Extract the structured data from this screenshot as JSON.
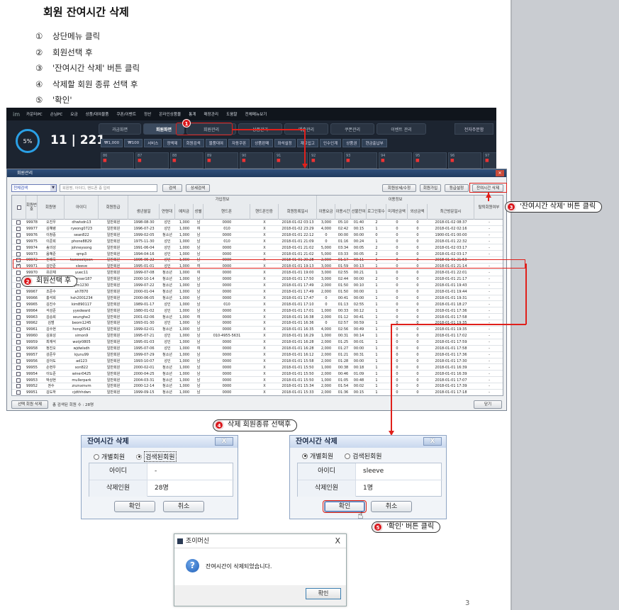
{
  "doc": {
    "title": "회원 잔여시간 삭제",
    "steps": [
      {
        "num": "①",
        "text": "상단메뉴 클릭"
      },
      {
        "num": "②",
        "text": "회원선택 후"
      },
      {
        "num": "③",
        "text": "'잔여시간 삭제' 버튼 클릭"
      },
      {
        "num": "④",
        "text": "삭제할 회원 종류 선택 후"
      },
      {
        "num": "⑤",
        "text": "'확인'"
      }
    ],
    "page_number": "3"
  },
  "app": {
    "logo": "im",
    "menu": [
      "카운터PC",
      "손님PC",
      "요금",
      "상품/대여물품",
      "쿠폰/이벤트",
      "정산",
      "온라인상품몰",
      "통계",
      "매장관리",
      "도움말",
      "전체메뉴보기"
    ],
    "gauge": "5%",
    "count": "11 | 221",
    "tabs": [
      {
        "label": "과금화면",
        "active": false
      },
      {
        "label": "회원화면",
        "active": true
      },
      {
        "label": "회원관리",
        "active": false
      },
      {
        "label": "상품관리",
        "active": false
      },
      {
        "label": "매출관리",
        "active": false
      },
      {
        "label": "쿠폰관리",
        "active": false
      },
      {
        "label": "이벤트 관리",
        "active": false
      }
    ],
    "right_tab": "전자주문함",
    "toolbar": [
      "₩1,000",
      "₩100",
      "서비스",
      "정액제",
      "회원검색",
      "물품대여",
      "자동쿠폰",
      "상품판매",
      "좌석설정",
      "재고입고",
      "인수인계",
      "상품권",
      "현금출납부"
    ],
    "seats": [
      "86",
      "87",
      "88",
      "89",
      "90",
      "91",
      "92",
      "93",
      "94",
      "95",
      "96",
      "97"
    ]
  },
  "window": {
    "title": "회원관리",
    "search_select": "전체검색",
    "search_placeholder": "회원명, 아이디, 핸드폰 중 입력",
    "search_btn": "검색",
    "detail_search_btn": "상세검색",
    "btn_detail_edit": "회원상세/수정",
    "btn_join": "회원가입",
    "btn_grade": "등급설정",
    "btn_delete_time": "잔여시간 삭제",
    "group_join": "가입정보",
    "group_use": "이용정보",
    "headers": [
      "회원번호",
      "회원명",
      "아이디",
      "회원등급",
      "생년월일",
      "연령대",
      "예치금",
      "성별",
      "핸드폰",
      "핸드폰인증",
      "회원등록일시",
      "이용요금",
      "이용시간",
      "선불잔여",
      "로그인횟수",
      "미계산금액",
      "외상금액",
      "최근방문일시",
      "탈퇴회원여부"
    ],
    "rows": [
      [
        "99978",
        "오진우",
        "dhwlsdn13",
        "일반회원",
        "1998-08-30",
        "성인",
        "1,000",
        "남",
        "0000",
        "X",
        "2018-01-02 03:13",
        "3,000",
        "05:10",
        "01:40",
        "2",
        "0",
        "0",
        "2018-01-02 08:37",
        "-"
      ],
      [
        "99977",
        "김혜령",
        "ryeong0723",
        "일반회원",
        "1996-07-23",
        "성인",
        "1,000",
        "여",
        "010",
        "X",
        "2018-01-02 23:29",
        "4,000",
        "02:42",
        "00:15",
        "1",
        "0",
        "0",
        "2018-01-02 02:16",
        "-"
      ],
      [
        "99976",
        "이창중",
        "sean822",
        "일반회원",
        "1999-02-05",
        "청소년",
        "1,000",
        "남",
        "0000",
        "X",
        "2018-01-01 22:12",
        "0",
        "00:00",
        "00:00",
        "0",
        "0",
        "0",
        "1900-01-01 00:00",
        "-"
      ],
      [
        "99975",
        "이준희",
        "phone8829",
        "일반회원",
        "1975-11-30",
        "성인",
        "1,000",
        "남",
        "010",
        "X",
        "2018-01-01 21:09",
        "0",
        "01:16",
        "00:24",
        "1",
        "0",
        "0",
        "2018-01-01 22:32",
        "-"
      ],
      [
        "99974",
        "송의성",
        "johneysong",
        "일반회원",
        "1991-06-04",
        "성인",
        "1,000",
        "남",
        "0000",
        "X",
        "2018-01-01 21:02",
        "5,000",
        "03:34",
        "00:05",
        "2",
        "0",
        "0",
        "2018-01-02 03:17",
        "-"
      ],
      [
        "99973",
        "음혜준",
        "qmp3",
        "일반회원",
        "1994-04-16",
        "성인",
        "1,000",
        "남",
        "0000",
        "X",
        "2018-01-01 21:02",
        "5,000",
        "03:33",
        "00:05",
        "2",
        "0",
        "0",
        "2018-01-02 03:17",
        "-"
      ],
      [
        "99972",
        "전태육",
        "taewookjeon",
        "일반회원",
        "1996-06-22",
        "성인",
        "1,000",
        "남",
        "0000",
        "X",
        "2018-01-01 20:28",
        "2,000",
        "01:17",
        "00:11",
        "1",
        "0",
        "0",
        "2018-01-01 21:53",
        "-"
      ],
      [
        "99971",
        "김민준",
        "sleeve",
        "일반회원",
        "1995-01-01",
        "성인",
        "1,000",
        "여",
        "0000",
        "X",
        "2018-01-01 19:13",
        "3,000",
        "01:59",
        "00:13",
        "1",
        "0",
        "0",
        "2018-01-01 21:14",
        "-"
      ],
      [
        "99970",
        "유은채",
        "yuec11",
        "일반회원",
        "1999-07-08",
        "청소년",
        "1,000",
        "여",
        "0000",
        "X",
        "2018-01-01 19:00",
        "3,000",
        "02:55",
        "00:21",
        "1",
        "0",
        "0",
        "2018-01-01 22:01",
        "-"
      ],
      [
        "99969",
        "박지훈",
        "wlgnser187",
        "일반회원",
        "2000-10-14",
        "청소년",
        "1,000",
        "남",
        "0000",
        "X",
        "2018-01-01 17:50",
        "3,000",
        "02:44",
        "00:00",
        "2",
        "0",
        "0",
        "2018-01-01 21:17",
        "-"
      ],
      [
        "99968",
        "이서준",
        "jim1230",
        "일반회원",
        "1999-07-22",
        "청소년",
        "1,000",
        "남",
        "0000",
        "X",
        "2018-01-01 17:49",
        "2,000",
        "01:50",
        "00:10",
        "1",
        "0",
        "0",
        "2018-01-01 19:43",
        "-"
      ],
      [
        "99967",
        "조준수",
        "ah7870",
        "일반회원",
        "2000-01-04",
        "청소년",
        "1,000",
        "남",
        "0000",
        "X",
        "2018-01-01 17:49",
        "2,000",
        "01:50",
        "00:00",
        "1",
        "0",
        "0",
        "2018-01-01 19:44",
        "-"
      ],
      [
        "99966",
        "홍석희",
        "hsh2001234",
        "일반회원",
        "2000-06-05",
        "청소년",
        "1,000",
        "남",
        "0000",
        "X",
        "2018-01-01 17:47",
        "0",
        "00:41",
        "00:00",
        "1",
        "0",
        "0",
        "2018-01-01 19:31",
        "-"
      ],
      [
        "99965",
        "김진수",
        "kim890117",
        "일반회원",
        "1989-01-17",
        "성인",
        "1,000",
        "남",
        "010",
        "X",
        "2018-01-01 17:10",
        "0",
        "01:13",
        "02:55",
        "1",
        "0",
        "0",
        "2018-01-01 18:27",
        "-"
      ],
      [
        "99964",
        "석성준",
        "yyedward",
        "일반회원",
        "1980-01-02",
        "성인",
        "1,000",
        "남",
        "0000",
        "X",
        "2018-01-01 17:01",
        "1,000",
        "00:33",
        "00:12",
        "1",
        "0",
        "0",
        "2018-01-01 17:36",
        "-"
      ],
      [
        "99963",
        "김승희",
        "seunghe2",
        "일반회원",
        "2001-02-06",
        "청소년",
        "1,000",
        "여",
        "0000",
        "X",
        "2018-01-01 16:38",
        "2,000",
        "01:12",
        "00:41",
        "1",
        "0",
        "0",
        "2018-01-01 17:58",
        "-"
      ],
      [
        "99962",
        "김범",
        "beom1245",
        "일반회원",
        "1993-01-30",
        "성인",
        "1,000",
        "남",
        "0000",
        "X",
        "2018-01-01 16:36",
        "0",
        "02:57",
        "00:59",
        "1",
        "0",
        "0",
        "2018-01-01 19:35",
        "-"
      ],
      [
        "99961",
        "김수현",
        "hong0542",
        "일반회원",
        "1999-02-01",
        "청소년",
        "1,000",
        "남",
        "0000",
        "X",
        "2018-01-01 16:35",
        "4,000",
        "02:56",
        "00:49",
        "1",
        "0",
        "0",
        "2018-01-01 19:35",
        "-"
      ],
      [
        "99960",
        "김호성",
        "simon9",
        "일반회원",
        "1995-07-21",
        "성인",
        "1,000",
        "남",
        "010-4955-5631",
        "X",
        "2018-01-01 16:29",
        "1,000",
        "00:31",
        "00:14",
        "1",
        "0",
        "0",
        "2018-01-01 17:02",
        "-"
      ],
      [
        "99959",
        "최재석",
        "wotjr0805",
        "일반회원",
        "1995-01-03",
        "성인",
        "1,000",
        "남",
        "0000",
        "X",
        "2018-01-01 16:28",
        "2,000",
        "01:25",
        "00:01",
        "1",
        "0",
        "0",
        "2018-01-01 17:59",
        "-"
      ],
      [
        "99958",
        "정진오",
        "wjdwlsdh",
        "일반회원",
        "1995-07-06",
        "성인",
        "1,000",
        "여",
        "0000",
        "X",
        "2018-01-01 16:28",
        "2,000",
        "01:27",
        "00:00",
        "1",
        "0",
        "0",
        "2018-01-01 17:58",
        "-"
      ],
      [
        "99957",
        "강준우",
        "kjunu99",
        "일반회원",
        "1999-07-29",
        "청소년",
        "1,000",
        "남",
        "0000",
        "X",
        "2018-01-01 16:12",
        "2,000",
        "01:21",
        "00:31",
        "1",
        "0",
        "0",
        "2018-01-01 17:36",
        "-"
      ],
      [
        "99956",
        "김아도",
        "ad123",
        "일반회원",
        "1993-10-07",
        "성인",
        "1,000",
        "남",
        "0000",
        "X",
        "2018-01-01 15:58",
        "2,000",
        "01:28",
        "00:00",
        "1",
        "0",
        "0",
        "2018-01-01 17:30",
        "-"
      ],
      [
        "99955",
        "손현우",
        "son822",
        "일반회원",
        "2000-02-01",
        "청소년",
        "1,000",
        "남",
        "0000",
        "X",
        "2018-01-01 15:50",
        "1,000",
        "00:38",
        "00:18",
        "1",
        "0",
        "0",
        "2018-01-01 16:39",
        "-"
      ],
      [
        "99954",
        "이도준",
        "winer0425",
        "일반회원",
        "2000-04-25",
        "청소년",
        "1,000",
        "남",
        "0000",
        "X",
        "2018-01-01 15:50",
        "2,000",
        "00:46",
        "01:09",
        "1",
        "0",
        "0",
        "2018-01-01 16:39",
        "-"
      ],
      [
        "99953",
        "박상현",
        "mullerpark",
        "일반회원",
        "2004-03-31",
        "청소년",
        "1,000",
        "남",
        "0000",
        "X",
        "2018-01-01 15:50",
        "1,000",
        "01:05",
        "00:48",
        "1",
        "0",
        "0",
        "2018-01-01 17:07",
        "-"
      ],
      [
        "99952",
        "권수",
        "znznxmvm",
        "일반회원",
        "2000-12-14",
        "청소년",
        "1,000",
        "남",
        "0000",
        "X",
        "2018-01-01 15:34",
        "2,000",
        "01:54",
        "00:02",
        "1",
        "0",
        "0",
        "2018-01-01 17:39",
        "-"
      ],
      [
        "99951",
        "김도하",
        "cjdthhdwn",
        "일반회원",
        "1999-09-15",
        "청소년",
        "1,000",
        "남",
        "0000",
        "X",
        "2018-01-01 15:33",
        "2,000",
        "01:36",
        "00:15",
        "1",
        "0",
        "0",
        "2018-01-01 17:18",
        "-"
      ]
    ],
    "checked_row": 7,
    "btn_selected_delete": "선택 회원 삭제",
    "count_text": "총 검색된 회원 수 : 28명",
    "btn_close": "닫기"
  },
  "annotations": {
    "c2": {
      "num": "2",
      "text": "회원선택 후"
    },
    "c3": {
      "num": "3",
      "text": "'잔여시간 삭제' 버튼 클릭"
    },
    "c4": {
      "num": "4",
      "text": "삭제 회원종류 선택후"
    },
    "c5": {
      "num": "5",
      "text": "'확인' 버튼 클릭"
    },
    "b1": "1"
  },
  "dialog_left": {
    "title": "잔여시간 삭제",
    "close": "X",
    "radio_individual": "개별회원",
    "radio_searched": "검색된회원",
    "selected": "searched",
    "id_label": "아이디",
    "id_value": "-",
    "count_label": "삭제인원",
    "count_value": "28명",
    "ok": "확인",
    "cancel": "취소"
  },
  "dialog_right": {
    "title": "잔여시간 삭제",
    "close": "X",
    "radio_individual": "개별회원",
    "radio_searched": "검색된회원",
    "selected": "individual",
    "id_label": "아이디",
    "id_value": "sleeve",
    "count_label": "삭제인원",
    "count_value": "1명",
    "ok": "확인",
    "cancel": "취소"
  },
  "confirm": {
    "title": "조이머신",
    "close": "X",
    "message": "잔여시간이 삭제되었습니다.",
    "ok": "확인"
  }
}
